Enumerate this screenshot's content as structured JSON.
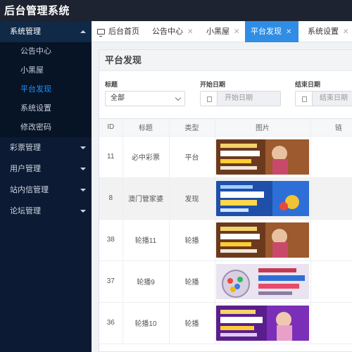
{
  "app": {
    "title": "后台管理系统"
  },
  "sidebar": {
    "groups": [
      {
        "label": "系统管理",
        "expanded": true,
        "items": [
          {
            "label": "公告中心"
          },
          {
            "label": "小黑屋"
          },
          {
            "label": "平台发现",
            "active": true
          },
          {
            "label": "系统设置"
          },
          {
            "label": "修改密码"
          }
        ]
      },
      {
        "label": "彩票管理",
        "expanded": false
      },
      {
        "label": "用户管理",
        "expanded": false
      },
      {
        "label": "站内信管理",
        "expanded": false
      },
      {
        "label": "论坛管理",
        "expanded": false
      }
    ]
  },
  "tabs": [
    {
      "label": "后台首页",
      "icon": "monitor-icon"
    },
    {
      "label": "公告中心"
    },
    {
      "label": "小黑屋"
    },
    {
      "label": "平台发现",
      "active": true
    },
    {
      "label": "系统设置"
    }
  ],
  "panel": {
    "title": "平台发现",
    "filters": {
      "title_label": "标题",
      "title_value": "全部",
      "start_label": "开始日期",
      "start_placeholder": "开始日期",
      "end_label": "结束日期",
      "end_placeholder": "结束日期"
    }
  },
  "table": {
    "headers": [
      "ID",
      "标题",
      "类型",
      "图片",
      "链"
    ],
    "rows": [
      {
        "id": "11",
        "title": "必中彩票",
        "type": "平台",
        "image": "banner-brown"
      },
      {
        "id": "8",
        "title": "澳门管家婆",
        "type": "发现",
        "image": "banner-blue"
      },
      {
        "id": "38",
        "title": "轮播11",
        "type": "轮播",
        "image": "banner-brown"
      },
      {
        "id": "37",
        "title": "轮播9",
        "type": "轮播",
        "image": "banner-lottery"
      },
      {
        "id": "36",
        "title": "轮播10",
        "type": "轮播",
        "image": "banner-purple"
      }
    ]
  },
  "colors": {
    "sidebar_bg": "#0c1b33",
    "topbar_bg": "#1e2331",
    "accent": "#2f8de4"
  }
}
